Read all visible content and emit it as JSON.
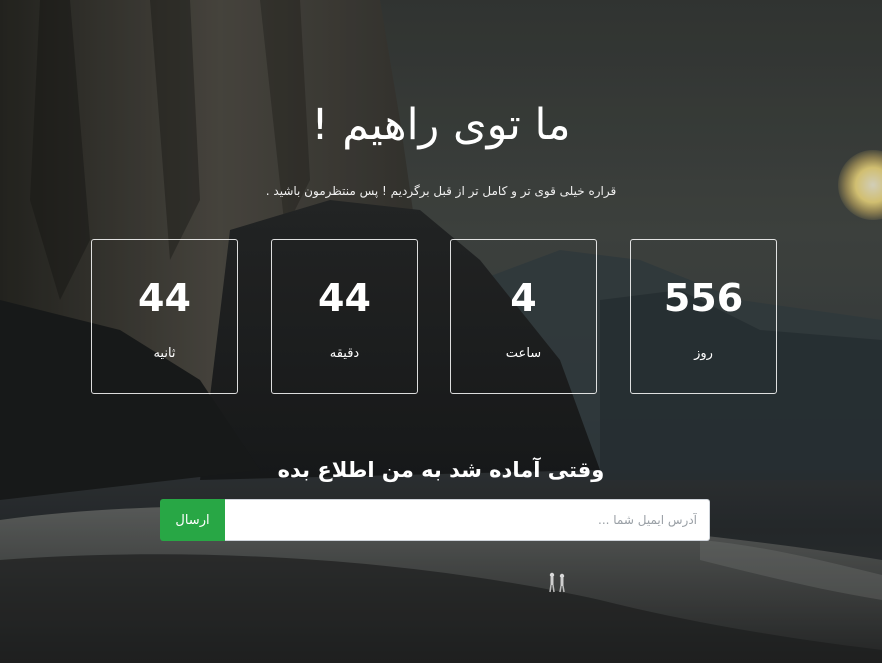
{
  "hero": {
    "title": "ما توی راهیم !",
    "subtitle": "قراره خیلی قوی تر و کامل تر از قبل برگردیم ! پس منتظرمون باشید ."
  },
  "countdown": [
    {
      "value": "556",
      "label": "روز"
    },
    {
      "value": "4",
      "label": "ساعت"
    },
    {
      "value": "44",
      "label": "دقیقه"
    },
    {
      "value": "44",
      "label": "ثانیه"
    }
  ],
  "notify": {
    "title": "وقتی آماده شد به من اطلاع بده",
    "email_placeholder": "آدرس ایمیل شما ...",
    "email_value": "",
    "submit_label": "ارسال"
  },
  "colors": {
    "accent": "#28a745",
    "text": "#ffffff"
  }
}
